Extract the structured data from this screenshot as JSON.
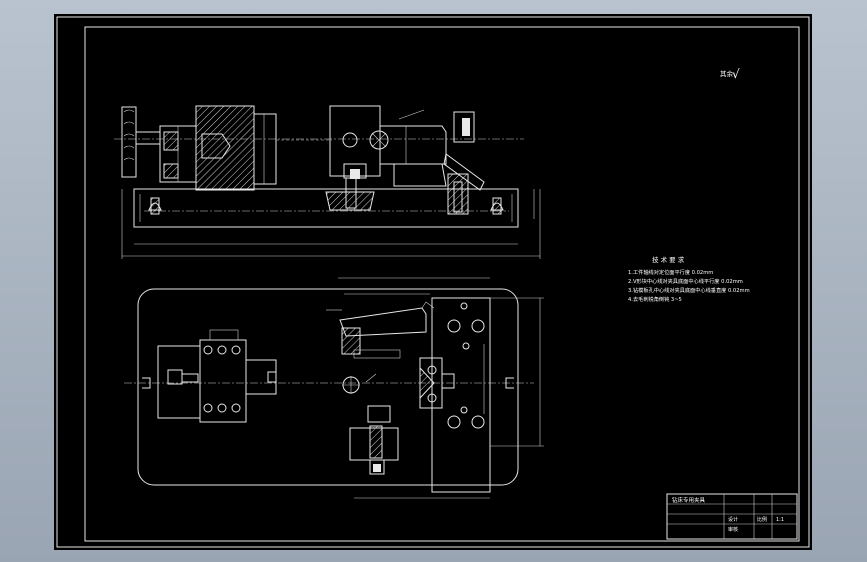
{
  "colors": {
    "paper": "#000000",
    "line": "#e8e8e8",
    "viewport": "#aab4c2",
    "highlight": "#3a3ad6"
  },
  "roughness_mark": {
    "label": "其余",
    "symbol": "√"
  },
  "technical_requirements": {
    "title": "技 术 要 求",
    "items": [
      "1.工件轴线对定位面平行度 0.02mm",
      "2.V形块中心线对夹具底面中心线平行度 0.02mm",
      "3.钻模板孔中心线对夹具底面中心线垂直度 0.02mm",
      "4.去毛刺锐角倒钝 3~5"
    ]
  },
  "title_block": {
    "drawing_name": "钻床专用夹具",
    "row_labels": [
      "设计",
      "审核"
    ],
    "scale_label": "比例",
    "scale_value": "1:1"
  }
}
